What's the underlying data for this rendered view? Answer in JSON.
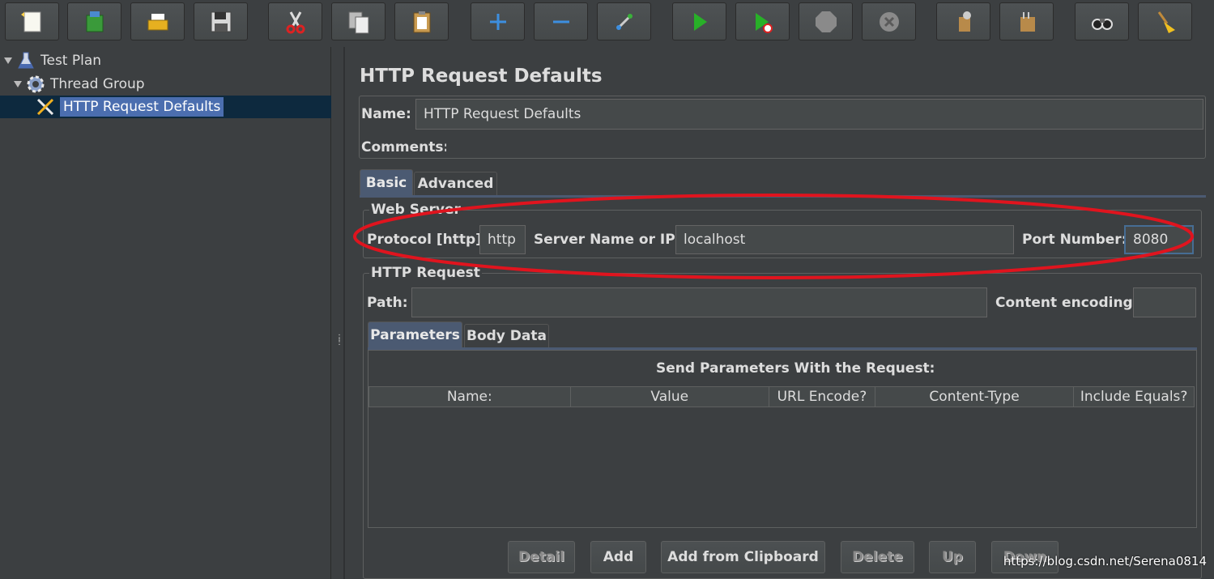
{
  "toolbar": {
    "buttons": [
      {
        "name": "new-icon"
      },
      {
        "name": "templates-icon"
      },
      {
        "name": "open-icon"
      },
      {
        "name": "save-icon"
      },
      {
        "name": "cut-icon"
      },
      {
        "name": "copy-icon"
      },
      {
        "name": "paste-icon"
      },
      {
        "name": "expand-icon"
      },
      {
        "name": "collapse-icon"
      },
      {
        "name": "toggle-icon"
      },
      {
        "name": "start-icon"
      },
      {
        "name": "start-no-pauses-icon"
      },
      {
        "name": "stop-icon"
      },
      {
        "name": "shutdown-icon"
      },
      {
        "name": "clear-icon"
      },
      {
        "name": "clear-all-icon"
      },
      {
        "name": "search-icon"
      },
      {
        "name": "reset-search-icon"
      }
    ]
  },
  "tree": {
    "items": [
      {
        "label": "Test Plan",
        "icon": "flask-icon"
      },
      {
        "label": "Thread Group",
        "icon": "gear-icon"
      },
      {
        "label": "HTTP Request Defaults",
        "icon": "wrench-screwdriver-icon"
      }
    ]
  },
  "main": {
    "title": "HTTP Request Defaults",
    "name_label": "Name:",
    "name_value": "HTTP Request Defaults",
    "comments_label": "Comments:",
    "tabs": [
      {
        "label": "Basic"
      },
      {
        "label": "Advanced"
      }
    ],
    "web_server": {
      "title": "Web Server",
      "protocol_label": "Protocol [http]:",
      "protocol_value": "http",
      "server_label": "Server Name or IP:",
      "server_value": "localhost",
      "port_label": "Port Number:",
      "port_value": "8080"
    },
    "http_request": {
      "title": "HTTP Request",
      "path_label": "Path:",
      "path_value": "",
      "encoding_label": "Content encoding:",
      "encoding_value": ""
    },
    "inner_tabs": [
      {
        "label": "Parameters"
      },
      {
        "label": "Body Data"
      }
    ],
    "params_heading": "Send Parameters With the Request:",
    "columns": [
      "Name:",
      "Value",
      "URL Encode?",
      "Content-Type",
      "Include Equals?"
    ],
    "buttons": {
      "detail": "Detail",
      "add": "Add",
      "add_clipboard": "Add from Clipboard",
      "delete": "Delete",
      "up": "Up",
      "down": "Down"
    }
  },
  "watermark": "https://blog.csdn.net/Serena0814",
  "colors": {
    "background": "#3c3f41",
    "selection": "#4b6eaf",
    "tab_active": "#4b5a72",
    "annotation": "#e0141e"
  }
}
